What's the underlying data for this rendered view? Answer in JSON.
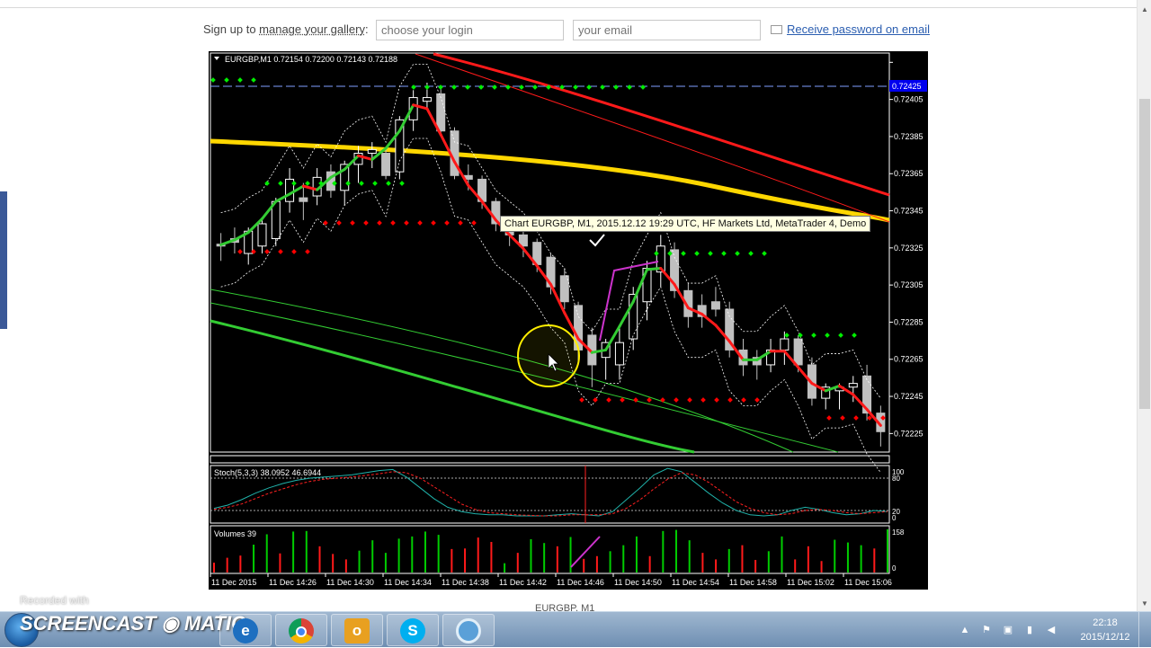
{
  "signup": {
    "prefix": "Sign up to ",
    "link": "manage your gallery",
    "suffix": ":",
    "login_placeholder": "choose your login",
    "email_placeholder": "your email",
    "receive_link": "Receive password on email"
  },
  "chart": {
    "header": "EURGBP,M1  0.72154 0.72200 0.72143 0.72188",
    "price_ticks": [
      "0.72425",
      "0.72405",
      "0.72385",
      "0.72365",
      "0.72345",
      "0.72325",
      "0.72305",
      "0.72285",
      "0.72265",
      "0.72245",
      "0.72225"
    ],
    "current_price_label": "0.72425",
    "tooltip": "Chart EURGBP, M1, 2015.12.12 19:29 UTC, HF Markets Ltd, MetaTrader 4, Demo",
    "stoch_label": "Stoch(5,3,3) 38.0952 46.6944",
    "stoch_ticks": [
      "100",
      "80",
      "20",
      "0"
    ],
    "volumes_label": "Volumes 39",
    "volume_ticks": [
      "158",
      "0"
    ],
    "time_labels": [
      "11 Dec 2015",
      "11 Dec 14:26",
      "11 Dec 14:30",
      "11 Dec 14:34",
      "11 Dec 14:38",
      "11 Dec 14:42",
      "11 Dec 14:46",
      "11 Dec 14:50",
      "11 Dec 14:54",
      "11 Dec 14:58",
      "11 Dec 15:02",
      "11 Dec 15:06"
    ],
    "caption": "EURGBP, M1",
    "colors": {
      "background": "#000000",
      "bull": "#ffffff",
      "bear": "#c0c0c0",
      "ma_red": "#ff1a1a",
      "ma_yellow": "#ffd700",
      "ma_green": "#33cc33",
      "dots_green": "#00ee00",
      "dots_red": "#ff0000",
      "annotation": "#cc33cc"
    }
  },
  "chart_data": {
    "type": "candlestick",
    "symbol": "EURGBP",
    "timeframe": "M1",
    "ylim": [
      0.72215,
      0.7243
    ],
    "candles": [
      [
        0.72327,
        0.72333,
        0.72318,
        0.72326
      ],
      [
        0.7233,
        0.72336,
        0.72322,
        0.72328
      ],
      [
        0.72322,
        0.72336,
        0.72316,
        0.72334
      ],
      [
        0.72326,
        0.7234,
        0.72322,
        0.72338
      ],
      [
        0.7233,
        0.72352,
        0.72326,
        0.7235
      ],
      [
        0.7235,
        0.72368,
        0.72344,
        0.72362
      ],
      [
        0.72352,
        0.7236,
        0.7234,
        0.7235
      ],
      [
        0.72353,
        0.72368,
        0.72348,
        0.72363
      ],
      [
        0.72366,
        0.7237,
        0.72352,
        0.72356
      ],
      [
        0.72356,
        0.72372,
        0.72348,
        0.7237
      ],
      [
        0.7237,
        0.7238,
        0.7236,
        0.72376
      ],
      [
        0.72376,
        0.72382,
        0.72368,
        0.72378
      ],
      [
        0.72376,
        0.72378,
        0.72362,
        0.72364
      ],
      [
        0.72366,
        0.72396,
        0.72362,
        0.72394
      ],
      [
        0.72394,
        0.7241,
        0.72388,
        0.72406
      ],
      [
        0.72404,
        0.72414,
        0.724,
        0.72406
      ],
      [
        0.72408,
        0.72412,
        0.72386,
        0.72388
      ],
      [
        0.72388,
        0.7239,
        0.72362,
        0.72364
      ],
      [
        0.72364,
        0.7237,
        0.72356,
        0.72362
      ],
      [
        0.72362,
        0.72364,
        0.72346,
        0.7235
      ],
      [
        0.7235,
        0.72352,
        0.72334,
        0.72338
      ],
      [
        0.72338,
        0.72342,
        0.72326,
        0.72332
      ],
      [
        0.72332,
        0.72336,
        0.7232,
        0.72326
      ],
      [
        0.72328,
        0.7233,
        0.72312,
        0.72316
      ],
      [
        0.7232,
        0.72322,
        0.723,
        0.72304
      ],
      [
        0.7231,
        0.72314,
        0.72292,
        0.72296
      ],
      [
        0.72294,
        0.72296,
        0.72262,
        0.7227
      ],
      [
        0.72278,
        0.72282,
        0.7225,
        0.72262
      ],
      [
        0.72266,
        0.72276,
        0.72254,
        0.72274
      ],
      [
        0.72262,
        0.72282,
        0.72254,
        0.72274
      ],
      [
        0.72276,
        0.72304,
        0.7227,
        0.723
      ],
      [
        0.72296,
        0.72318,
        0.72286,
        0.72314
      ],
      [
        0.72312,
        0.72332,
        0.72304,
        0.72326
      ],
      [
        0.72324,
        0.72328,
        0.72298,
        0.72302
      ],
      [
        0.72302,
        0.72306,
        0.72282,
        0.72288
      ],
      [
        0.72294,
        0.723,
        0.72282,
        0.72288
      ],
      [
        0.72296,
        0.72304,
        0.72288,
        0.72292
      ],
      [
        0.72292,
        0.72296,
        0.72266,
        0.7227
      ],
      [
        0.7227,
        0.72276,
        0.72256,
        0.72262
      ],
      [
        0.72266,
        0.7227,
        0.72254,
        0.72262
      ],
      [
        0.72262,
        0.72276,
        0.72258,
        0.7227
      ],
      [
        0.7227,
        0.7228,
        0.72262,
        0.72276
      ],
      [
        0.72276,
        0.72278,
        0.72258,
        0.72262
      ],
      [
        0.72262,
        0.72266,
        0.7224,
        0.72244
      ],
      [
        0.72244,
        0.72252,
        0.72238,
        0.7225
      ],
      [
        0.72248,
        0.72252,
        0.72238,
        0.7225
      ],
      [
        0.7225,
        0.72256,
        0.72242,
        0.72252
      ],
      [
        0.72256,
        0.72262,
        0.72232,
        0.72236
      ],
      [
        0.72236,
        0.7224,
        0.72218,
        0.72226
      ]
    ],
    "stoch_k": [
      24,
      30,
      40,
      52,
      62,
      70,
      76,
      80,
      82,
      84,
      86,
      90,
      94,
      96,
      82,
      62,
      42,
      26,
      18,
      14,
      12,
      12,
      10,
      10,
      10,
      12,
      14,
      12,
      10,
      18,
      40,
      62,
      86,
      98,
      92,
      72,
      52,
      34,
      20,
      12,
      10,
      12,
      20,
      26,
      22,
      16,
      12,
      14,
      20,
      18
    ],
    "stoch_d": [
      22,
      26,
      32,
      42,
      52,
      60,
      68,
      74,
      78,
      80,
      82,
      85,
      88,
      92,
      90,
      80,
      64,
      48,
      32,
      22,
      16,
      14,
      12,
      11,
      10,
      10,
      12,
      12,
      12,
      14,
      24,
      40,
      60,
      78,
      90,
      86,
      72,
      54,
      36,
      24,
      16,
      12,
      14,
      20,
      22,
      20,
      16,
      14,
      16,
      18
    ],
    "volumes": [
      36,
      54,
      62,
      102,
      140,
      70,
      150,
      152,
      96,
      68,
      48,
      80,
      118,
      72,
      124,
      132,
      150,
      138,
      86,
      88,
      128,
      112,
      34,
      72,
      122,
      108,
      96,
      130,
      50,
      60,
      78,
      100,
      132,
      60,
      152,
      156,
      118,
      72,
      48,
      86,
      100,
      46,
      78,
      132,
      48,
      96,
      42,
      120,
      110,
      100,
      88,
      158
    ],
    "volume_up": [
      false,
      false,
      false,
      true,
      true,
      false,
      true,
      true,
      false,
      false,
      false,
      true,
      true,
      true,
      true,
      true,
      true,
      true,
      false,
      false,
      false,
      false,
      true,
      false,
      true,
      true,
      false,
      true,
      false,
      false,
      true,
      true,
      true,
      false,
      true,
      true,
      true,
      false,
      false,
      true,
      false,
      false,
      true,
      true,
      false,
      false,
      false,
      true,
      true,
      true,
      false,
      true
    ]
  }
}
